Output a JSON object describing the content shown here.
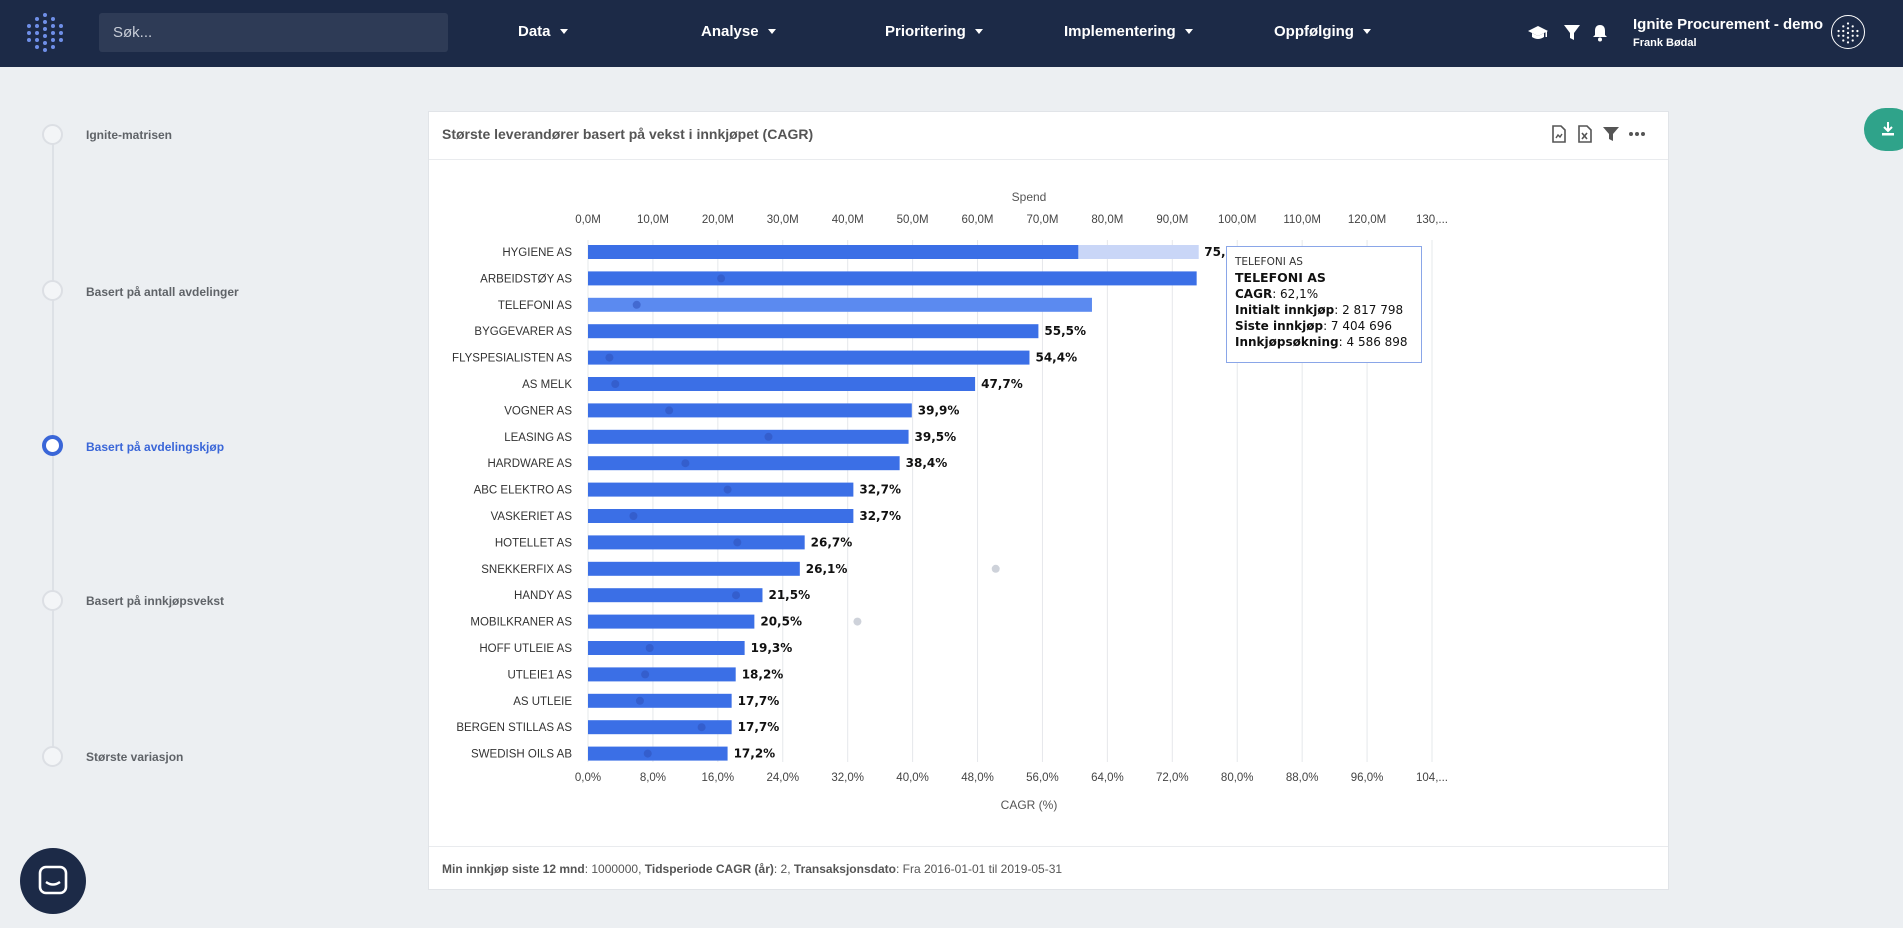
{
  "search": {
    "placeholder": "Søk..."
  },
  "nav": [
    {
      "label": "Data"
    },
    {
      "label": "Analyse"
    },
    {
      "label": "Prioritering"
    },
    {
      "label": "Implementering"
    },
    {
      "label": "Oppfølging"
    }
  ],
  "header": {
    "org": "Ignite Procurement - demo",
    "user": "Frank Bødal"
  },
  "steps": [
    {
      "label": "Ignite-matrisen",
      "active": false
    },
    {
      "label": "Basert på antall avdelinger",
      "active": false
    },
    {
      "label": "Basert på avdelingskjøp",
      "active": true
    },
    {
      "label": "Basert på innkjøpsvekst",
      "active": false
    },
    {
      "label": "Største variasjon",
      "active": false
    }
  ],
  "card": {
    "title": "Største leverandører basert på vekst i innkjøpet (CAGR)",
    "footer": {
      "k1": "Min innkjøp siste 12 mnd",
      "v1": ": 1000000, ",
      "k2": "Tidsperiode CAGR (år)",
      "v2": ": 2, ",
      "k3": "Transaksjonsdato",
      "v3": ": Fra 2016-01-01 til 2019-05-31"
    }
  },
  "tooltip": {
    "small": "TELEFONI AS",
    "name": "TELEFONI AS",
    "rows": [
      {
        "key": "CAGR",
        "value": ": 62,1%"
      },
      {
        "key": "Initialt innkjøp",
        "value": ": 2 817 798"
      },
      {
        "key": "Siste innkjøp",
        "value": ": 7 404 696"
      },
      {
        "key": "Innkjøpsøkning",
        "value": ": 4 586 898"
      }
    ]
  },
  "colors": {
    "nav_bg": "#1c2a47",
    "bar": "#3b6fe6",
    "bar_hover": "#5b8af0",
    "accent": "#3a66d8",
    "download": "#2fa38a"
  },
  "chart_data": {
    "type": "bar",
    "orientation": "horizontal",
    "categories": [
      "HYGIENE AS",
      "ARBEIDSTØY AS",
      "TELEFONI AS",
      "BYGGEVARER AS",
      "FLYSPESIALISTEN AS",
      "AS MELK",
      "VOGNER AS",
      "LEASING AS",
      "HARDWARE AS",
      "ABC ELEKTRO AS",
      "VASKERIET AS",
      "HOTELLET AS",
      "SNEKKERFIX AS",
      "HANDY AS",
      "MOBILKRANER AS",
      "HOFF UTLEIE AS",
      "UTLEIE1 AS",
      "AS UTLEIE",
      "BERGEN STILLAS AS",
      "SWEDISH OILS AB"
    ],
    "series": [
      {
        "name": "CAGR (%)",
        "values": [
          75.2,
          75.0,
          62.1,
          55.5,
          54.4,
          47.7,
          39.9,
          39.5,
          38.4,
          32.7,
          32.7,
          26.7,
          26.1,
          21.5,
          20.5,
          19.3,
          18.2,
          17.7,
          17.7,
          17.2
        ]
      },
      {
        "name": "Spend",
        "values": [
          null,
          20.5,
          7.5,
          121.5,
          3.3,
          4.2,
          12.5,
          27.8,
          15.0,
          21.5,
          7.0,
          23.0,
          62.8,
          22.8,
          41.5,
          9.5,
          8.8,
          8.0,
          17.5,
          9.2
        ]
      }
    ],
    "data_labels": [
      "75,2%",
      "",
      "",
      "55,5%",
      "54,4%",
      "47,7%",
      "39,9%",
      "39,5%",
      "38,4%",
      "32,7%",
      "32,7%",
      "26,7%",
      "26,1%",
      "21,5%",
      "20,5%",
      "19,3%",
      "18,2%",
      "17,7%",
      "17,7%",
      "17,2%"
    ],
    "highlight_index": 2,
    "faded_points": [
      3,
      12,
      14
    ],
    "xlabel": "CAGR (%)",
    "x2label": "Spend",
    "xlim": [
      0,
      104
    ],
    "x2lim": [
      0,
      130
    ],
    "x_ticks": [
      "0,0%",
      "8,0%",
      "16,0%",
      "24,0%",
      "32,0%",
      "40,0%",
      "48,0%",
      "56,0%",
      "64,0%",
      "72,0%",
      "80,0%",
      "88,0%",
      "96,0%",
      "104,..."
    ],
    "x2_ticks": [
      "0,0M",
      "10,0M",
      "20,0M",
      "30,0M",
      "40,0M",
      "50,0M",
      "60,0M",
      "70,0M",
      "80,0M",
      "90,0M",
      "100,0M",
      "110,0M",
      "120,0M",
      "130,..."
    ],
    "grid": true
  }
}
